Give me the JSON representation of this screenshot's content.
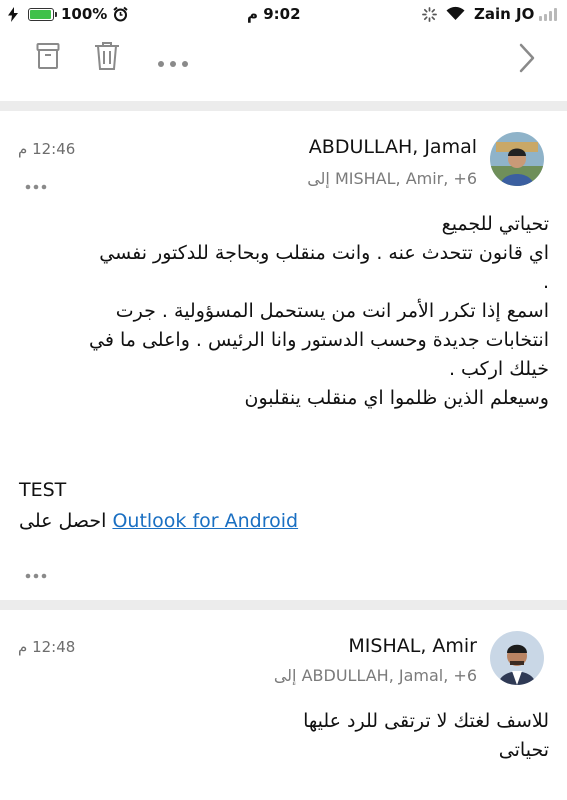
{
  "status_bar": {
    "battery_percent": "100%",
    "time": "9:02 م",
    "carrier": "Zain JO",
    "battery_level": 1.0,
    "battery_color": "#3fc14a"
  },
  "toolbar": {
    "icons": [
      "archive-icon",
      "trash-icon",
      "more-icon",
      "chevron-right-icon"
    ]
  },
  "messages": [
    {
      "sender": "ABDULLAH, Jamal",
      "recipients": "إلى MISHAL, Amir, +6",
      "time": "12:46 م",
      "body": [
        "تحياتي للجميع",
        "اي قانون تتحدث عنه . وانت منقلب وبحاجة للدكتور نفسي",
        ".",
        "اسمع إذا تكرر الأمر انت من يستحمل المسؤولية . جرت",
        "انتخابات جديدة وحسب الدستور وانا الرئيس . واعلى ما في",
        "خيلك اركب .",
        "وسيعلم الذين ظلموا اي منقلب ينقلبون"
      ],
      "signature_label": "TEST",
      "footer_prefix": "احصل على",
      "footer_link": "Outlook for Android"
    },
    {
      "sender": "MISHAL, Amir",
      "recipients": "إلى ABDULLAH, Jamal, +6",
      "time": "12:48 م",
      "body": [
        "للاسف لغتك لا ترتقى للرد عليها",
        "تحياتى"
      ]
    }
  ],
  "colors": {
    "link": "#1a6fc2",
    "muted": "#7b7b7b",
    "divider": "#ececec"
  }
}
